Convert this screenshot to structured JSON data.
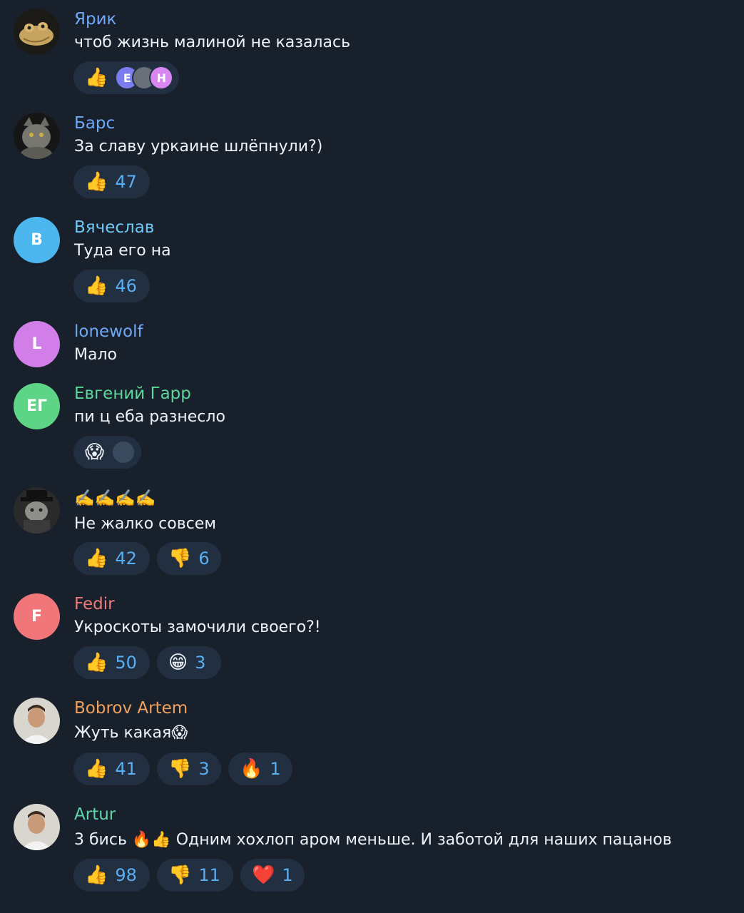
{
  "messages": [
    {
      "author": "Ярик",
      "author_color": "#6fa8f5",
      "text": "чтоб жизнь малиной не казалась",
      "avatar": {
        "type": "image",
        "icon": "frog-toad-icon"
      },
      "reactions": [
        {
          "emoji": "👍",
          "voters": [
            {
              "initial": "E",
              "color": "#7b7cf0"
            },
            {
              "initial": "",
              "color": "#6a6f7a",
              "icon": "user-photo-icon"
            },
            {
              "initial": "Н",
              "color": "#d987f0"
            }
          ]
        }
      ]
    },
    {
      "author": "Барс",
      "author_color": "#6fa8f5",
      "text": "За славу уркаине шлёпнули?)",
      "avatar": {
        "type": "image",
        "icon": "cat-icon"
      },
      "reactions": [
        {
          "emoji": "👍",
          "count": "47"
        }
      ]
    },
    {
      "author": "Вячеслав",
      "author_color": "#6fc8f5",
      "text": "Туда его на",
      "avatar": {
        "type": "letter",
        "letter": "В",
        "color": "#4cb6ee"
      },
      "reactions": [
        {
          "emoji": "👍",
          "count": "46"
        }
      ]
    },
    {
      "author": "lonewolf",
      "author_color": "#6fa8f5",
      "text": "Мало",
      "avatar": {
        "type": "letter",
        "letter": "L",
        "color": "#d27ee8"
      },
      "reactions": []
    },
    {
      "author": "Евгений Гарр",
      "author_color": "#5fd69b",
      "text": "пи  ц еба   разнесло",
      "avatar": {
        "type": "letter",
        "letter": "ЕГ",
        "color": "#5ed486"
      },
      "reactions": [
        {
          "emoji": "😱",
          "voters": [
            {
              "initial": "",
              "color": "#3a4a5e",
              "icon": "user-photo-icon"
            }
          ]
        }
      ]
    },
    {
      "author": "✍️✍️✍️✍️",
      "author_color": "#f2c24e",
      "text": "Не жалко совсем",
      "avatar": {
        "type": "image",
        "icon": "hat-cat-icon"
      },
      "reactions": [
        {
          "emoji": "👍",
          "count": "42"
        },
        {
          "emoji": "👎",
          "count": "6"
        }
      ]
    },
    {
      "author": "Fedir",
      "author_color": "#f07b7b",
      "text": "Укроскоты замочили своего?!",
      "avatar": {
        "type": "letter",
        "letter": "F",
        "color": "#f0767a"
      },
      "reactions": [
        {
          "emoji": "👍",
          "count": "50"
        },
        {
          "emoji": "😁",
          "count": "3"
        }
      ]
    },
    {
      "author": "Bobrov Artem",
      "author_color": "#f0a15e",
      "text": "Жуть какая😱",
      "avatar": {
        "type": "image",
        "icon": "man-photo-icon"
      },
      "reactions": [
        {
          "emoji": "👍",
          "count": "41"
        },
        {
          "emoji": "👎",
          "count": "3"
        },
        {
          "emoji": "🔥",
          "count": "1"
        }
      ]
    },
    {
      "author": "Artur",
      "author_color": "#5fd6a8",
      "text": "3 бись 🔥👍 Одним хохлоп  аром меньше. И заботой для наших пацанов",
      "avatar": {
        "type": "image",
        "icon": "man-photo-icon"
      },
      "reactions": [
        {
          "emoji": "👍",
          "count": "98"
        },
        {
          "emoji": "👎",
          "count": "11"
        },
        {
          "emoji": "❤️",
          "count": "1"
        }
      ]
    }
  ]
}
